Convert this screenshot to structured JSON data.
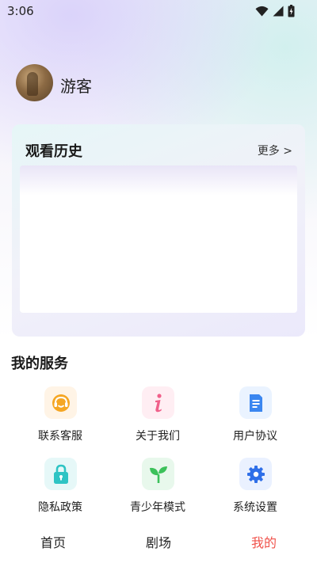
{
  "status_bar": {
    "time": "3:06",
    "icons": [
      "wifi-icon",
      "signal-icon",
      "battery-icon"
    ]
  },
  "profile": {
    "username": "游客"
  },
  "history": {
    "title": "观看历史",
    "more_label": "更多 >"
  },
  "services": {
    "title": "我的服务",
    "items": [
      {
        "label": "联系客服",
        "icon": "headset-icon",
        "color": "#f5a623"
      },
      {
        "label": "关于我们",
        "icon": "info-icon",
        "color": "#f0608a"
      },
      {
        "label": "用户协议",
        "icon": "document-icon",
        "color": "#3a86f0"
      },
      {
        "label": "隐私政策",
        "icon": "lock-icon",
        "color": "#2ec4c4"
      },
      {
        "label": "青少年模式",
        "icon": "sprout-icon",
        "color": "#3cc15a"
      },
      {
        "label": "系统设置",
        "icon": "gear-icon",
        "color": "#2f6fe8"
      }
    ]
  },
  "bottom_nav": {
    "items": [
      {
        "label": "首页",
        "active": false
      },
      {
        "label": "剧场",
        "active": false
      },
      {
        "label": "我的",
        "active": true
      }
    ],
    "active_color": "#f0524b"
  }
}
